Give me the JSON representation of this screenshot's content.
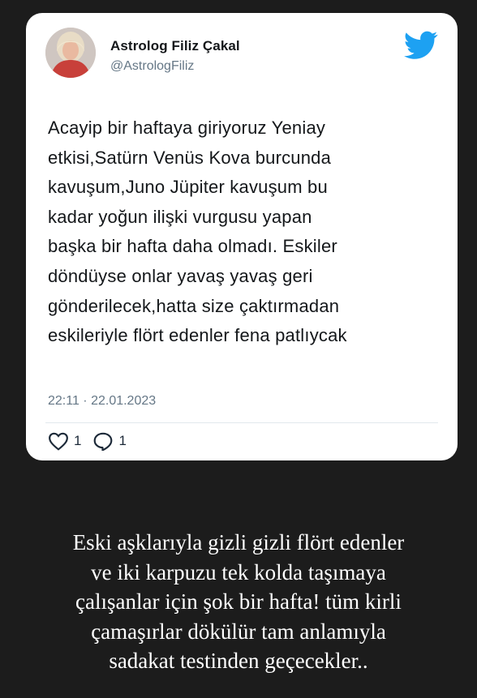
{
  "tweet": {
    "author_name": "Astrolog Filiz Çakal",
    "author_handle": "@AstrologFiliz",
    "brand_icon": "twitter-bird-icon",
    "text_lines": [
      "Acayip bir haftaya giriyoruz Yeniay",
      "etkisi,Satürn Venüs Kova burcunda",
      "kavuşum,Juno Jüpiter kavuşum bu",
      "kadar yoğun ilişki vurgusu yapan",
      "başka bir hafta daha olmadı. Eskiler",
      "döndüyse onlar yavaş yavaş geri",
      "gönderilecek,hatta size çaktırmadan",
      "eskileriyle flört edenler fena patlıycak"
    ],
    "timestamp": "22:11 · 22.01.2023",
    "likes": "1",
    "replies": "1"
  },
  "caption": {
    "lines": [
      "Eski aşklarıyla gizli gizli flört edenler",
      "ve iki karpuzu tek kolda taşımaya",
      "çalışanlar için şok bir hafta! tüm kirli",
      "çamaşırlar dökülür tam anlamıyla",
      "sadakat testinden geçecekler.."
    ]
  },
  "colors": {
    "background": "#1c1c1c",
    "card": "#ffffff",
    "twitter_blue": "#1da1f2",
    "secondary_text": "#657786"
  }
}
